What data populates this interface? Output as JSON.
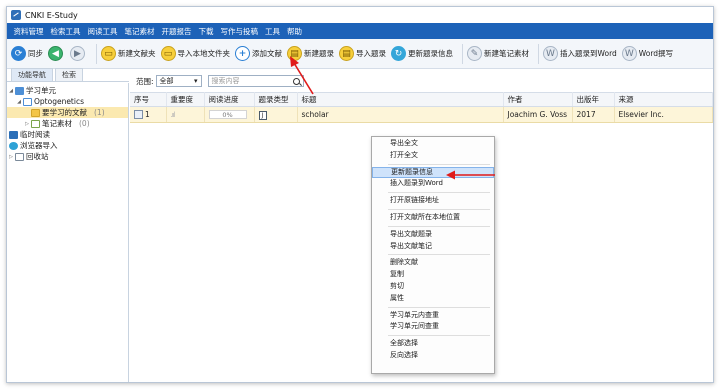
{
  "window": {
    "title": "CNKI E-Study",
    "accent": "#1d62b8"
  },
  "menubar": {
    "items": [
      "资料管理",
      "检索工具",
      "阅读工具",
      "笔记素材",
      "开题报告",
      "下载",
      "写作与投稿",
      "工具",
      "帮助"
    ]
  },
  "toolbar": {
    "buttons": [
      {
        "label": "同步",
        "icon": "sync-icon"
      },
      {
        "label": "",
        "icon": "back-arrow-icon"
      },
      {
        "label": "",
        "icon": "forward-arrow-icon"
      },
      {
        "label": "新建文献夹",
        "icon": "new-folder-icon"
      },
      {
        "label": "导入本地文件夹",
        "icon": "import-folder-icon"
      },
      {
        "label": "添加文献",
        "icon": "add-icon"
      },
      {
        "label": "新建题录",
        "icon": "new-record-icon"
      },
      {
        "label": "导入题录",
        "icon": "import-record-icon"
      },
      {
        "label": "更新题录信息",
        "icon": "update-record-icon"
      },
      {
        "label": "新建笔记素材",
        "icon": "new-note-icon"
      },
      {
        "label": "插入题录到Word",
        "icon": "insert-word-icon"
      },
      {
        "label": "Word撰写",
        "icon": "word-write-icon"
      }
    ]
  },
  "sidebar": {
    "tabs": [
      "功能导航",
      "检索"
    ],
    "items": [
      {
        "label": "学习单元",
        "count": ""
      },
      {
        "label": "Optogenetics",
        "count": ""
      },
      {
        "label": "要学习的文献",
        "count": "(1)"
      },
      {
        "label": "笔记素材",
        "count": "(0)"
      },
      {
        "label": "临时阅读",
        "count": ""
      },
      {
        "label": "浏览器导入",
        "count": ""
      },
      {
        "label": "回收站",
        "count": ""
      }
    ]
  },
  "filter": {
    "scope_label": "范围:",
    "scope_value": "全部",
    "search_placeholder": "搜索内容"
  },
  "table": {
    "headers": [
      "序号",
      "重要度",
      "阅读进度",
      "题录类型",
      "标题",
      "作者",
      "出版年",
      "来源"
    ],
    "rows": [
      {
        "index": "1",
        "importance": "",
        "progress": "0%",
        "type": "J",
        "title": "scholar",
        "author": "Joachim G. Voss",
        "year": "2017",
        "source": "Elsevier Inc."
      }
    ]
  },
  "context_menu": {
    "groups": [
      [
        "导出全文",
        "打开全文"
      ],
      [
        "更新题录信息",
        "插入题录到Word"
      ],
      [
        "打开原链接地址"
      ],
      [
        "打开文献所在本地位置"
      ],
      [
        "导出文献题录",
        "导出文献笔记"
      ],
      [
        "删除文献",
        "复制",
        "剪切",
        "属性"
      ],
      [
        "学习单元内查重",
        "学习单元间查重"
      ],
      [
        "全部选择",
        "反向选择"
      ]
    ],
    "highlighted": "更新题录信息"
  },
  "annotation_color": "#e01b1b"
}
